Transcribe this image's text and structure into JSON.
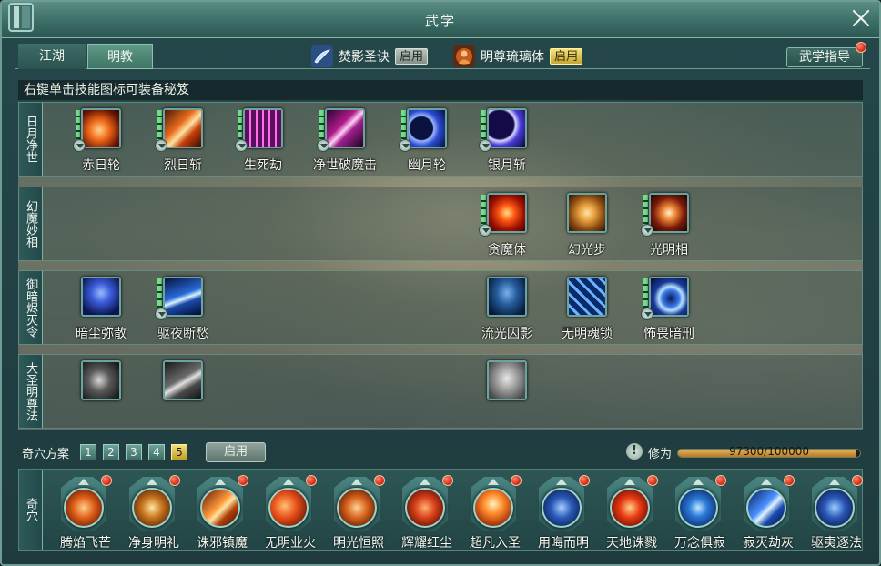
{
  "window": {
    "title": "武学"
  },
  "tabs": [
    {
      "label": "江湖"
    },
    {
      "label": "明教"
    }
  ],
  "secrets": [
    {
      "name": "焚影圣诀",
      "status": "启用",
      "icon": "feather-icon"
    },
    {
      "name": "明尊琉璃体",
      "status": "启用",
      "icon": "monk-icon"
    }
  ],
  "guide_button": {
    "label": "武学指导"
  },
  "hint": "右键单击技能图标可装备秘笈",
  "rows": [
    {
      "label": "日月净世",
      "skills": [
        "赤日轮",
        "烈日斩",
        "生死劫",
        "净世破魔击",
        "幽月轮",
        "银月斩"
      ]
    },
    {
      "label": "幻魔妙相",
      "skills": [
        "贪魔体",
        "幻光步",
        "光明相"
      ]
    },
    {
      "label": "御暗烬灭令",
      "skills": [
        "暗尘弥散",
        "驱夜断愁",
        "流光囚影",
        "无明魂锁",
        "怖畏暗刑"
      ]
    },
    {
      "label": "大圣明尊法",
      "skills": []
    }
  ],
  "plan": {
    "label": "奇穴方案",
    "numbers": [
      "1",
      "2",
      "3",
      "4",
      "5"
    ],
    "active": "5",
    "enable_label": "启用"
  },
  "xiuwei": {
    "label": "修为",
    "text": "97300/100000",
    "current": 97300,
    "max": 100000
  },
  "qixue": {
    "label": "奇穴",
    "nodes": [
      "腾焰飞芒",
      "净身明礼",
      "诛邪镇魔",
      "无明业火",
      "明光恒照",
      "辉耀红尘",
      "超凡入圣",
      "用晦而明",
      "天地诛戮",
      "万念俱寂",
      "寂灭劫灰",
      "驱夷逐法"
    ]
  }
}
